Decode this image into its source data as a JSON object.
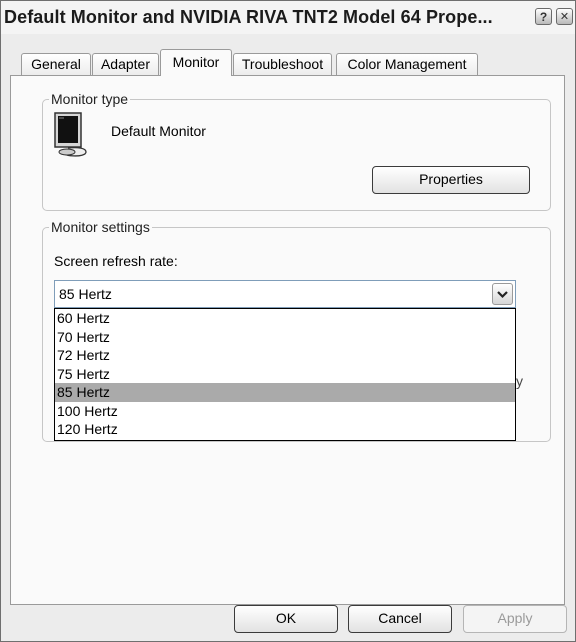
{
  "window": {
    "title": "Default Monitor and NVIDIA RIVA TNT2 Model 64 Prope...",
    "help_glyph": "?",
    "close_glyph": "✕"
  },
  "tabs": [
    {
      "label": "General"
    },
    {
      "label": "Adapter"
    },
    {
      "label": "Monitor",
      "active": true
    },
    {
      "label": "Troubleshoot"
    },
    {
      "label": "Color Management"
    }
  ],
  "monitor_type": {
    "legend": "Monitor type",
    "name": "Default Monitor",
    "properties_label": "Properties",
    "icon": "monitor-icon"
  },
  "monitor_settings": {
    "legend": "Monitor settings",
    "refresh_label": "Screen refresh rate:",
    "selected_rate": "85 Hertz",
    "options": [
      "60 Hertz",
      "70 Hertz",
      "72 Hertz",
      "75 Hertz",
      "85 Hertz",
      "100 Hertz",
      "120 Hertz"
    ],
    "selected_index": 4,
    "partial_glyph": "y"
  },
  "footer": {
    "ok_label": "OK",
    "cancel_label": "Cancel",
    "apply_label": "Apply"
  },
  "colors": {
    "selection": "#aaaaaa",
    "border": "#3b3b3b"
  }
}
